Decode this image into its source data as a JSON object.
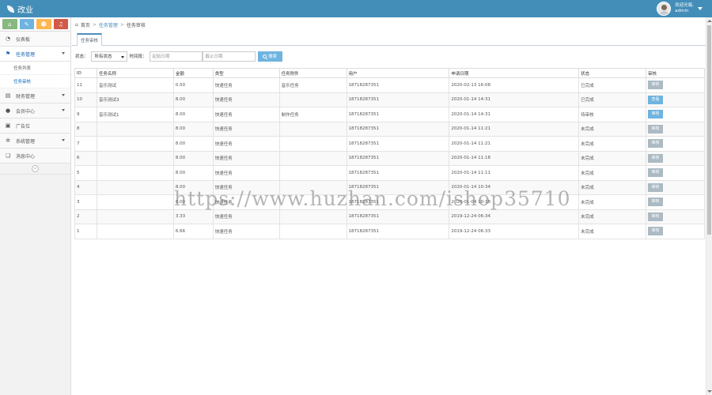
{
  "header": {
    "brand": "改业",
    "user": {
      "name": "欢迎光临,",
      "role": "admin"
    }
  },
  "sidebar": {
    "shortcuts": [
      {
        "icon": "signal-icon",
        "glyph": "⌂",
        "color": "green"
      },
      {
        "icon": "pencil-icon",
        "glyph": "✎",
        "color": "blue"
      },
      {
        "icon": "users-icon",
        "glyph": "☻",
        "color": "orange"
      },
      {
        "icon": "bell-icon",
        "glyph": "♫",
        "color": "red"
      }
    ],
    "items": [
      {
        "label": "仪表板",
        "icon": "dashboard-icon",
        "glyph": "◔"
      },
      {
        "label": "任务管理",
        "icon": "flag-icon",
        "glyph": "⚑",
        "open": true,
        "children": [
          {
            "label": "任务列表"
          },
          {
            "label": "任务审核",
            "active": true
          }
        ]
      },
      {
        "label": "财务管理",
        "icon": "print-icon",
        "glyph": "▤"
      },
      {
        "label": "会员中心",
        "icon": "user-icon",
        "glyph": "●"
      },
      {
        "label": "广告位",
        "icon": "picture-icon",
        "glyph": "▣"
      },
      {
        "label": "系统管理",
        "icon": "cogs-icon",
        "glyph": "✲"
      },
      {
        "label": "消息中心",
        "icon": "bookmark-icon",
        "glyph": "❏"
      }
    ]
  },
  "breadcrumb": {
    "home": "首页",
    "sep": ">",
    "parent": "任务管理",
    "current": "任务审核"
  },
  "tab": {
    "label": "任务审核"
  },
  "filter": {
    "status_label": "状态：",
    "status_value": "所有状态",
    "time_label": "时间段：",
    "start_placeholder": "起始日期",
    "end_placeholder": "截止日期",
    "search_label": "搜索"
  },
  "table": {
    "columns": [
      "ID",
      "任务名称",
      "金额",
      "类型",
      "任务附件",
      "用户",
      "申请日期",
      "状态",
      "审核"
    ],
    "rows": [
      {
        "id": "11",
        "name": "音乐测试",
        "amount": "0.50",
        "type": "快速任务",
        "attach": "音乐任务",
        "user": "18718287351",
        "date": "2020-02-13 16:08",
        "status": "已完成",
        "status_kind": "ok",
        "op": "审核",
        "op_color": "gray"
      },
      {
        "id": "10",
        "name": "音乐测试3",
        "amount": "8.00",
        "type": "快速任务",
        "attach": "",
        "user": "18718287351",
        "date": "2020-01-14 14:31",
        "status": "已完成",
        "status_kind": "ok",
        "op": "查看",
        "op_color": "blue"
      },
      {
        "id": "9",
        "name": "音乐测试1",
        "amount": "8.00",
        "type": "快速任务",
        "attach": "制作任务",
        "user": "18718287351",
        "date": "2020-01-14 14:31",
        "status": "待审核",
        "status_kind": "audit",
        "op": "审核",
        "op_color": "blue"
      },
      {
        "id": "8",
        "name": "",
        "amount": "8.00",
        "type": "快速任务",
        "attach": "",
        "user": "18718287351",
        "date": "2020-01-14 11:21",
        "status": "未完成",
        "status_kind": "ok",
        "op": "审核",
        "op_color": "gray"
      },
      {
        "id": "7",
        "name": "",
        "amount": "8.00",
        "type": "快速任务",
        "attach": "",
        "user": "18718287351",
        "date": "2020-01-14 11:21",
        "status": "未完成",
        "status_kind": "ok",
        "op": "审核",
        "op_color": "gray"
      },
      {
        "id": "6",
        "name": "",
        "amount": "8.00",
        "type": "快速任务",
        "attach": "",
        "user": "18718287351",
        "date": "2020-01-14 11:18",
        "status": "未完成",
        "status_kind": "ok",
        "op": "审核",
        "op_color": "gray"
      },
      {
        "id": "5",
        "name": "",
        "amount": "8.00",
        "type": "快速任务",
        "attach": "",
        "user": "18718287351",
        "date": "2020-01-14 11:11",
        "status": "未完成",
        "status_kind": "ok",
        "op": "审核",
        "op_color": "gray"
      },
      {
        "id": "4",
        "name": "",
        "amount": "8.00",
        "type": "快速任务",
        "attach": "",
        "user": "18718287351",
        "date": "2020-01-14 10:34",
        "status": "未完成",
        "status_kind": "ok",
        "op": "审核",
        "op_color": "gray"
      },
      {
        "id": "3",
        "name": "",
        "amount": "8.00",
        "type": "快速任务",
        "attach": "",
        "user": "18718287351",
        "date": "2020-01-04 10:18",
        "status": "未完成",
        "status_kind": "ok",
        "op": "审核",
        "op_color": "gray"
      },
      {
        "id": "2",
        "name": "",
        "amount": "3.33",
        "type": "快速任务",
        "attach": "",
        "user": "18718287351",
        "date": "2019-12-24 06:34",
        "status": "未完成",
        "status_kind": "ok",
        "op": "审核",
        "op_color": "gray"
      },
      {
        "id": "1",
        "name": "",
        "amount": "6.66",
        "type": "快速任务",
        "attach": "",
        "user": "18718287351",
        "date": "2019-12-24 06:33",
        "status": "未完成",
        "status_kind": "ok",
        "op": "审核",
        "op_color": "gray"
      }
    ]
  },
  "watermark": "https://www.huzhan.com/ishop35710",
  "colors": {
    "header": "#438eb9",
    "accent": "#6fb3e0",
    "link": "#4c8fbd"
  }
}
